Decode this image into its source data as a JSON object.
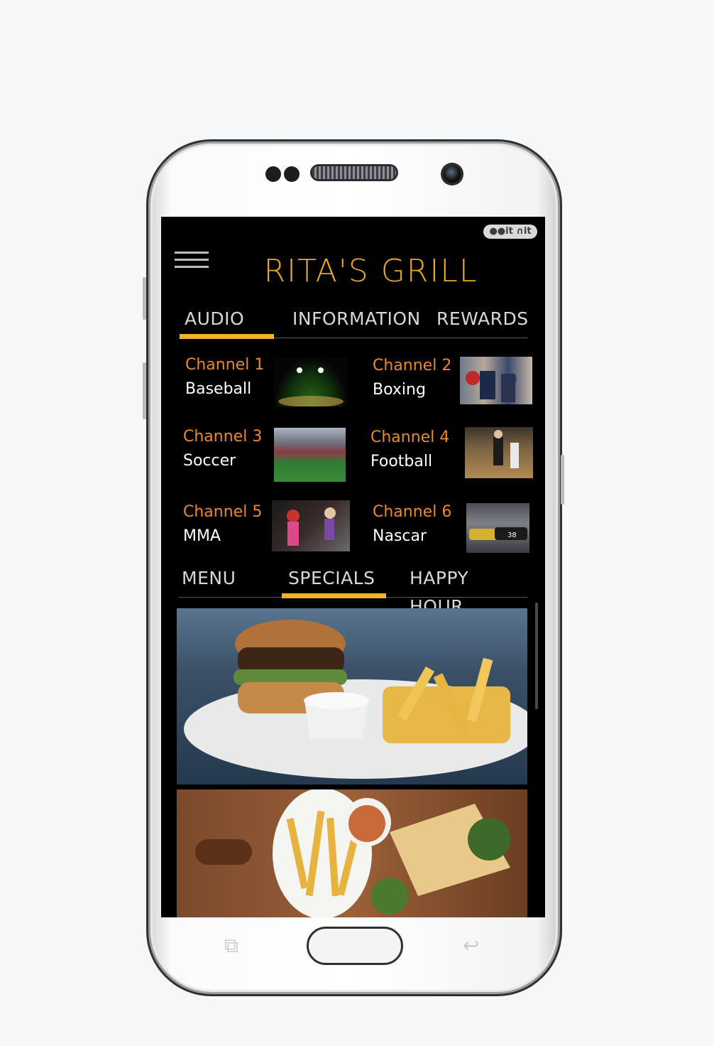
{
  "app": {
    "badge_text": "●●it ∩it",
    "logo": "RITA'S GRILL"
  },
  "top_tabs": [
    {
      "label": "AUDIO",
      "active": true
    },
    {
      "label": "INFORMATION",
      "active": false
    },
    {
      "label": "REWARDS",
      "active": false
    }
  ],
  "channels": [
    {
      "number": "Channel 1",
      "name": "Baseball"
    },
    {
      "number": "Channel 2",
      "name": "Boxing"
    },
    {
      "number": "Channel 3",
      "name": "Soccer"
    },
    {
      "number": "Channel 4",
      "name": "Football"
    },
    {
      "number": "Channel 5",
      "name": "MMA"
    },
    {
      "number": "Channel 6",
      "name": "Nascar"
    }
  ],
  "bottom_tabs": [
    {
      "label": "MENU",
      "active": false
    },
    {
      "label": "SPECIALS",
      "active": true
    },
    {
      "label": "HAPPY HOUR",
      "active": false
    }
  ],
  "colors": {
    "accent": "#f0b323",
    "channel_number": "#e8892b",
    "logo": "#e6a92a",
    "background": "#000000"
  }
}
